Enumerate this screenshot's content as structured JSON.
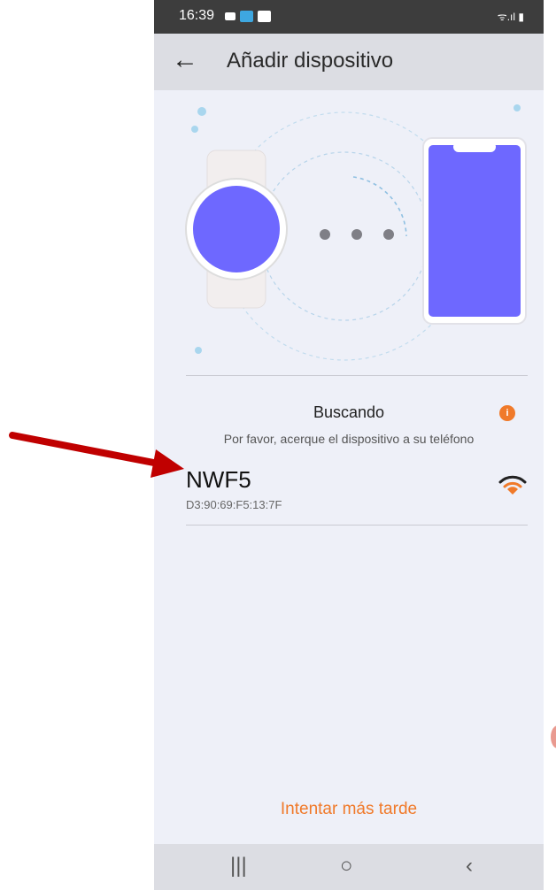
{
  "status_bar": {
    "time": "16:39",
    "right_icons": "ᯤ.ıl ▮"
  },
  "app_bar": {
    "back_icon": "←",
    "title": "Añadir dispositivo"
  },
  "search": {
    "status_label": "Buscando",
    "info_badge": "i",
    "hint": "Por favor, acerque el dispositivo a su teléfono"
  },
  "devices": [
    {
      "name": "NWF5",
      "mac": "D3:90:69:F5:13:7F",
      "signal_icon": "wifi-signal-icon"
    }
  ],
  "actions": {
    "retry_label": "Intentar más tarde"
  },
  "nav_bar": {
    "recent": "|||",
    "home": "○",
    "back": "‹"
  },
  "colors": {
    "accent": "#f07a2a",
    "device_fill": "#6e68ff",
    "arrow": "#c00000"
  }
}
